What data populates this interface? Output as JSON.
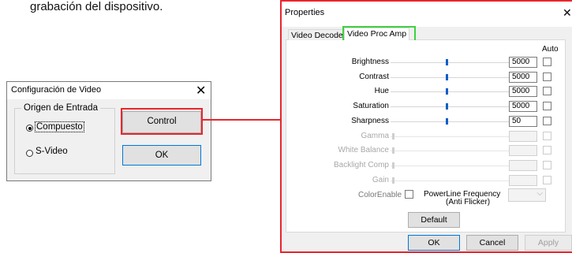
{
  "caption": "grabación del dispositivo.",
  "video_config": {
    "title": "Configuración de Video",
    "close_glyph": "✕",
    "group_label": "Origen de Entrada",
    "radio_composite": "Compuesto",
    "radio_svideo": "S-Video",
    "selected": "Compuesto",
    "control_button": "Control",
    "ok_button": "OK"
  },
  "properties": {
    "title": "Properties",
    "close_glyph": "✕",
    "tabs": [
      {
        "label": "Video Decoder",
        "active": false
      },
      {
        "label": "Video Proc Amp",
        "active": true
      }
    ],
    "auto_header": "Auto",
    "rows": [
      {
        "label": "Brightness",
        "value": "5000",
        "enabled": true,
        "level": 0.5
      },
      {
        "label": "Contrast",
        "value": "5000",
        "enabled": true,
        "level": 0.5
      },
      {
        "label": "Hue",
        "value": "5000",
        "enabled": true,
        "level": 0.5
      },
      {
        "label": "Saturation",
        "value": "5000",
        "enabled": true,
        "level": 0.5
      },
      {
        "label": "Sharpness",
        "value": "50",
        "enabled": true,
        "level": 0.5
      },
      {
        "label": "Gamma",
        "value": "",
        "enabled": false,
        "level": 0
      },
      {
        "label": "White Balance",
        "value": "",
        "enabled": false,
        "level": 0
      },
      {
        "label": "Backlight Comp",
        "value": "",
        "enabled": false,
        "level": 0
      },
      {
        "label": "Gain",
        "value": "",
        "enabled": false,
        "level": 0
      }
    ],
    "color_enable_label": "ColorEnable",
    "powerline_label_1": "PowerLine Frequency",
    "powerline_label_2": "(Anti Flicker)",
    "default_button": "Default",
    "ok_button": "OK",
    "cancel_button": "Cancel",
    "apply_button": "Apply"
  },
  "colors": {
    "highlight_red": "#e8262e",
    "highlight_green": "#3fd13f",
    "slider_thumb": "#0f5ec7"
  }
}
